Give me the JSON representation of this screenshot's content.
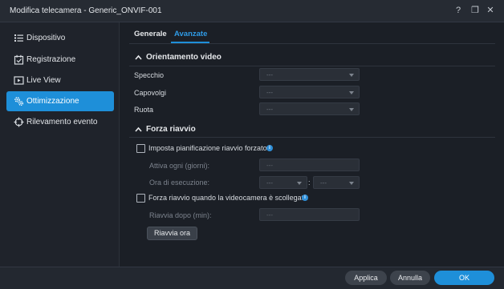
{
  "window": {
    "title": "Modifica telecamera - Generic_ONVIF-001",
    "help_glyph": "?",
    "maximize_glyph": "❐",
    "close_glyph": "✕"
  },
  "sidebar": {
    "items": [
      {
        "label": "Dispositivo",
        "icon": "list-icon",
        "active": false
      },
      {
        "label": "Registrazione",
        "icon": "calendar-check-icon",
        "active": false
      },
      {
        "label": "Live View",
        "icon": "play-screen-icon",
        "active": false
      },
      {
        "label": "Ottimizzazione",
        "icon": "gears-icon",
        "active": true
      },
      {
        "label": "Rilevamento evento",
        "icon": "crosshair-icon",
        "active": false
      }
    ]
  },
  "tabs": [
    {
      "label": "Generale",
      "active": false
    },
    {
      "label": "Avanzate",
      "active": true
    }
  ],
  "orientation": {
    "title": "Orientamento video",
    "fields": [
      {
        "label": "Specchio",
        "value": "---"
      },
      {
        "label": "Capovolgi",
        "value": "---"
      },
      {
        "label": "Ruota",
        "value": "---"
      }
    ]
  },
  "reboot": {
    "title": "Forza riavvio",
    "schedule_checkbox_label": "Imposta pianificazione riavvio forzato",
    "schedule_checked": false,
    "active_every_label": "Attiva ogni (giorni):",
    "active_every_value": "---",
    "exec_time_label": "Ora di esecuzione:",
    "exec_hour_value": "---",
    "time_separator": ":",
    "exec_minute_value": "---",
    "disconnect_checkbox_label": "Forza riavvio quando la videocamera è scollegata",
    "disconnect_checked": false,
    "reboot_after_label": "Riavvia dopo (min):",
    "reboot_after_value": "---",
    "reboot_now_button": "Riavvia ora",
    "info_glyph": "i"
  },
  "footer": {
    "apply": "Applica",
    "cancel": "Annulla",
    "ok": "OK"
  },
  "colors": {
    "accent": "#1e8fd9",
    "background": "#1b1f26",
    "sidebar_bg": "#1f232b"
  }
}
